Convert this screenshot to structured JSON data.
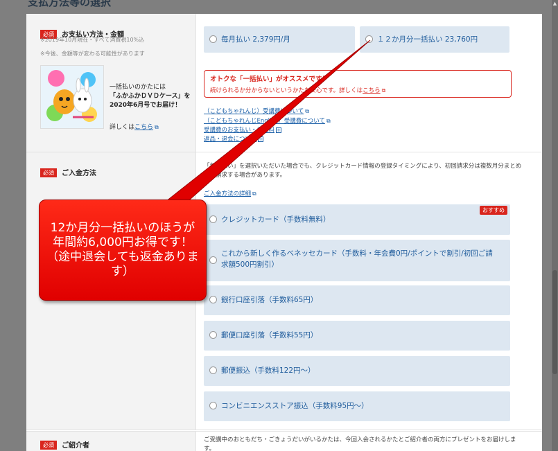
{
  "page": {
    "heading": "支払方法等の選択"
  },
  "payment_section": {
    "required": "必須",
    "title": "お支払い方法・金額",
    "note1": "※2019年10月現在・すべて消費税10%込",
    "note2": "※今後、金額等が変わる可能性があります",
    "promo_line1": "一括払いのかたには",
    "promo_line2": "「ふかふかＤＶＤケース」を",
    "promo_line3": "2020年6月号でお届け！",
    "detail_prefix": "詳しくは",
    "detail_link": "こちら",
    "options": [
      {
        "label": "毎月払い 2,379円/月"
      },
      {
        "label": "１２か月分一括払い 23,760円"
      }
    ],
    "alert_title": "オトクな「一括払い」がオススメです！",
    "alert_body": "続けられるか分からないというかたも安心です。詳しくは",
    "alert_link": "こちら",
    "links": [
      "（こどもちゃれんじ）受講費について",
      "（こどもちゃれんじEnglish）受講費について",
      "受講費のお支払い・手数料",
      "返品・退会について"
    ]
  },
  "deposit_section": {
    "required": "必須",
    "title": "ご入金方法",
    "info": "「毎月払い」を選択いただいた場合でも、クレジットカード情報の登録タイミングにより、初回請求分は複数月分まとめてご請求する場合があります。",
    "detail_link": "ご入金方法の詳細",
    "recommend_badge": "おすすめ",
    "options": [
      {
        "label": "クレジットカード（手数料無料）"
      },
      {
        "label": "これから新しく作るベネッセカード（手数料・年会費0円/ポイントで割引/初回ご請求額500円割引）"
      },
      {
        "label": "銀行口座引落（手数料65円）"
      },
      {
        "label": "郵便口座引落（手数料55円）"
      },
      {
        "label": "郵便振込（手数料122円〜）"
      },
      {
        "label": "コンビニエンスストア振込（手数料95円〜）"
      }
    ]
  },
  "referrer_section": {
    "required": "必須",
    "title": "ご紹介者",
    "info": "ご受講中のおともだち・ごきょうだいがいるかたは、今回入会されるかたとご紹介者の両方にプレゼントをお届けします。"
  },
  "callout": {
    "text": "12か月分一括払いのほうが年間約6,000円お得です！（途中退会しても返金あります）"
  },
  "colors": {
    "accent_red": "#d9251d",
    "option_bg": "#dde7f1",
    "link": "#1a5fa8"
  }
}
